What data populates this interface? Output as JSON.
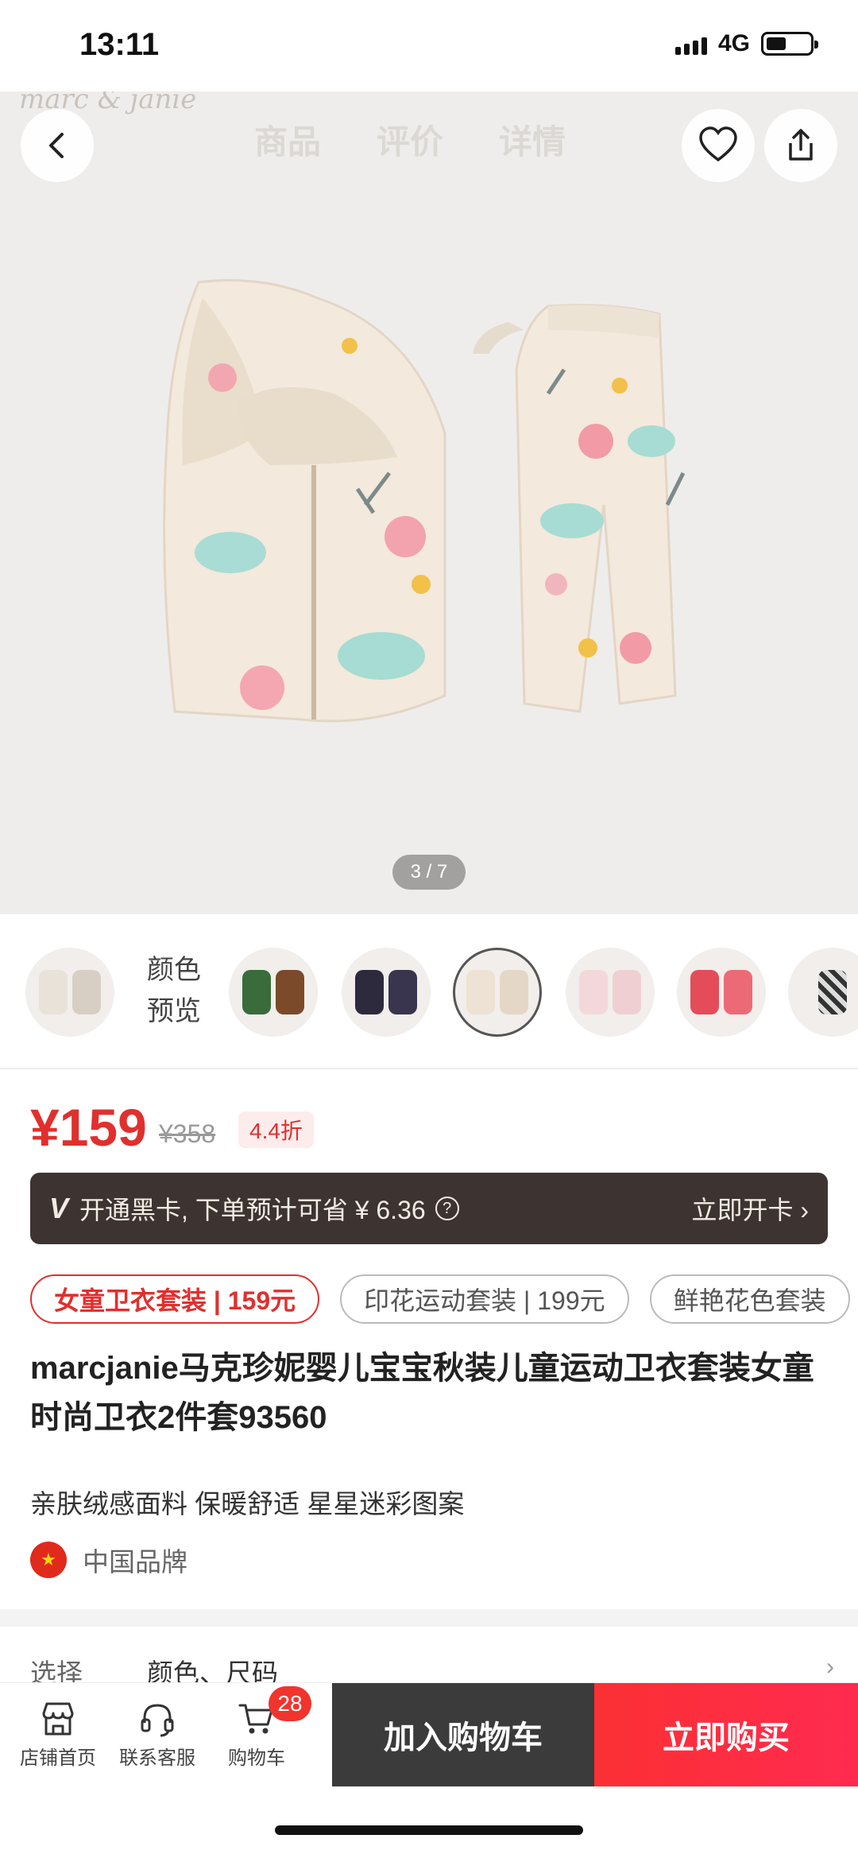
{
  "status_bar": {
    "time": "13:11",
    "network": "4G"
  },
  "hero": {
    "watermark": "marc & janie",
    "tabs": [
      "商品",
      "评价",
      "详情"
    ],
    "counter": "3 / 7"
  },
  "color_preview": {
    "label": "颜色\n预览",
    "thumbs": [
      {
        "name": "beige-tag",
        "colors": [
          "#e9e2d8",
          "#d7cfc3"
        ]
      },
      {
        "name": "green",
        "colors": [
          "#3a6b3a",
          "#7a4a2a"
        ]
      },
      {
        "name": "navy",
        "colors": [
          "#2d2a3e",
          "#3a354e"
        ]
      },
      {
        "name": "cream-floral",
        "colors": [
          "#ede2d3",
          "#e5d7c6"
        ]
      },
      {
        "name": "pink-light",
        "colors": [
          "#f4d8d9",
          "#f0cfd2"
        ]
      },
      {
        "name": "red",
        "colors": [
          "#e34c58",
          "#ec6a76"
        ]
      },
      {
        "name": "zebra",
        "colors": [
          "#333333",
          "#bdbdbd"
        ]
      }
    ]
  },
  "price": {
    "current": "¥159",
    "original": "¥358",
    "discount": "4.4折"
  },
  "black_card": {
    "icon": "V",
    "text": "开通黑卡, 下单预计可省 ¥ 6.36",
    "help": "?",
    "action": "立即开卡 ›"
  },
  "variants": [
    {
      "label": "女童卫衣套装 | 159元",
      "active": true
    },
    {
      "label": "印花运动套装 | 199元",
      "active": false
    },
    {
      "label": "鲜艳花色套装",
      "active": false
    }
  ],
  "product": {
    "title": "marcjanie马克珍妮婴儿宝宝秋装儿童运动卫衣套装女童时尚卫衣2件套93560",
    "subtitle": "亲肤绒感面料 保暖舒适 星星迷彩图案",
    "origin": "中国品牌"
  },
  "select": {
    "label": "选择",
    "value": "颜色、尺码"
  },
  "bottom_bar": {
    "store": "店铺首页",
    "service": "联系客服",
    "cart": "购物车",
    "cart_count": "28",
    "add_to_cart": "加入购物车",
    "buy_now": "立即购买"
  }
}
